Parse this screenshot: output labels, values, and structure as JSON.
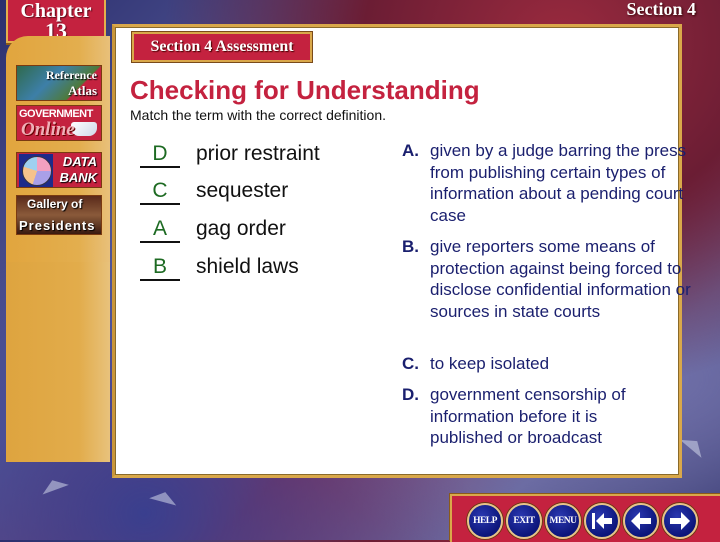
{
  "header": {
    "chapter_label": "Chapter",
    "chapter_number": "13",
    "section_label": "Section 4"
  },
  "sidebar": {
    "items": [
      {
        "line1": "Reference",
        "line2": "Atlas",
        "icon": "globe-map-icon"
      },
      {
        "line1": "GOVERNMENT",
        "line2": "Online",
        "icon": "book-icon"
      },
      {
        "line1": "DATA",
        "line2": "BANK",
        "icon": "pie-chart-icon"
      },
      {
        "line1": "Gallery of",
        "line2": "Presidents",
        "icon": "portraits-icon"
      }
    ]
  },
  "main": {
    "assessment_tab": "Section 4 Assessment",
    "title": "Checking for Understanding",
    "instructions": "Match the term with the correct definition.",
    "terms": [
      {
        "answer": "D",
        "term": "prior restraint"
      },
      {
        "answer": "C",
        "term": "sequester"
      },
      {
        "answer": "A",
        "term": "gag order"
      },
      {
        "answer": "B",
        "term": "shield laws"
      }
    ],
    "definitions": [
      {
        "letter": "A.",
        "text": "given by a judge barring the press from publishing certain types of information about a pending court case"
      },
      {
        "letter": "B.",
        "text": "give reporters some means of protection against being forced to disclose confidential information or sources in state courts"
      },
      {
        "letter": "C.",
        "text": "to keep isolated"
      },
      {
        "letter": "D.",
        "text": "government censorship of information before it is published or broadcast"
      }
    ]
  },
  "nav": {
    "help": "HELP",
    "exit": "EXIT",
    "menu": "MENU",
    "first_icon": "first-slide-icon",
    "back_icon": "back-arrow-icon",
    "next_icon": "next-arrow-icon"
  },
  "colors": {
    "title_red": "#c4223f",
    "answer_green": "#1d6a22",
    "definition_navy": "#1a1f6e",
    "gold": "#d9a84a",
    "nav_blue": "#0c157a"
  }
}
